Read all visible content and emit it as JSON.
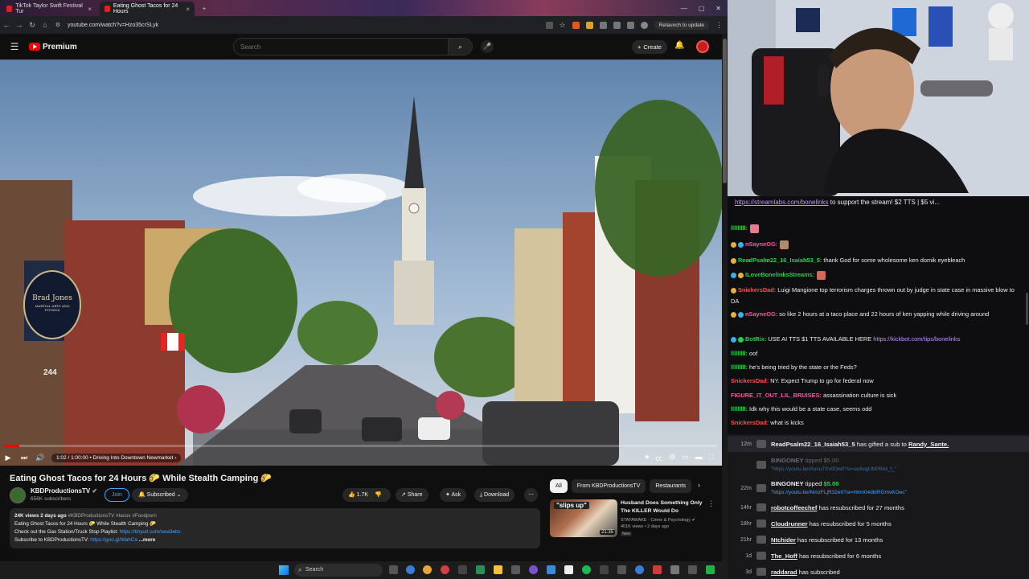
{
  "browser": {
    "tabs": [
      {
        "label": "TikTok Taylor Swift Festival Tur"
      },
      {
        "label": "Eating Ghost Tacos for 24 Hours"
      }
    ],
    "url": "youtube.com/watch?v=Hzo35crSLyk",
    "relaunch_label": "Relaunch to update"
  },
  "youtube": {
    "logo_text": "Premium",
    "search_placeholder": "Search",
    "create_label": "Create",
    "video": {
      "progress": 0.02,
      "time": "1:02 / 1:00:00",
      "chapter": "Driving Into Downtown Newmarket",
      "sign_text": "Brad Jones",
      "sign_sub": "MARTIAL ARTS AND FITNESS",
      "address_number": "244"
    },
    "title": "Eating Ghost Tacos for 24 Hours 🌮 While Stealth Camping 🌮",
    "channel": {
      "name": "KBDProductionsTV",
      "subscribers": "656K subscribers",
      "join_label": "Join",
      "subscribed_label": "Subscribed"
    },
    "actions": {
      "likes": "1.7K",
      "share": "Share",
      "ask": "Ask",
      "download": "Download"
    },
    "description": {
      "meta": "24K views  2 days ago",
      "tags": "#KBDProductionsTV #tacos #Foodporn",
      "line1": "Eating Ghost Tacos for 24 Hours 🌮 While Stealth Camping 🌮",
      "line2_prefix": "Check out the Gas Station/Truck Stop Playlist: ",
      "line2_link": "https://tinyurl.com/swa3ebs",
      "line3_prefix": "Subscribe to KBDProductionsTV: ",
      "line3_link": "https://goo.gl/WahCa",
      "more": "...more"
    },
    "chips": [
      "All",
      "From KBDProductionsTV",
      "Restaurants"
    ],
    "recommendation": {
      "thumb_caption": "\"slips up\"",
      "duration": "21:35",
      "title": "Husband Does Something Only The KILLER Would Do",
      "channel": "STAYAWAKE - Crime & Psychology",
      "views": "401K views • 2 days ago",
      "badge": "New"
    }
  },
  "taskbar": {
    "search_label": "Search"
  },
  "chat": {
    "top_link": "https://streamlabs.com/bonelinks",
    "top_text": " to support the stream! $2 TTS | $5 vi...",
    "messages": [
      {
        "user": "lllllllll:",
        "text": "",
        "color": "#1fd34a"
      },
      {
        "user": "nSayneOG:",
        "text": "",
        "color": "#ff4fa6"
      },
      {
        "user": "ReadPsalm22_16_Isaiah53_5:",
        "text": " thank God for some wholesome ken domik eyebleach",
        "color": "#1fd34a"
      },
      {
        "user": "ILoveBonelinksStreams:",
        "text": "",
        "color": "#1fd34a"
      },
      {
        "user": "SnickersDad:",
        "text": " Luigi Mangione top terrorism charges thrown out by judge in state case in massive blow to DA",
        "color": "#ff4f4f"
      },
      {
        "user": "nSayneOG:",
        "text": " so like 2 hours at a taco place and 22 hours of ken yapping while driving around",
        "color": "#ff4fa6"
      },
      {
        "user": "BotRix:",
        "text": " USE AI TTS $1 TTS AVAILABLE HERE ",
        "link": "https://kickbot.com/tips/bonelinks",
        "color": "#1fd34a"
      },
      {
        "user": "lllllllll:",
        "text": " oof",
        "color": "#1fd34a"
      },
      {
        "user": "lllllllll:",
        "text": " he's being tried by the state or the Feds?",
        "color": "#1fd34a"
      },
      {
        "user": "SnickersDad:",
        "text": " NY. Expect Trump to go for federal now",
        "color": "#ff4f4f"
      },
      {
        "user": "FIGURE_IT_OUT_LIL_BRUISES:",
        "text": " assassination culture is sick",
        "color": "#ff4fa6"
      },
      {
        "user": "lllllllll:",
        "text": " Idk why this would be a state case, seems odd",
        "color": "#1fd34a"
      },
      {
        "user": "SnickersDad:",
        "text": " what is kicks",
        "color": "#ff4f4f"
      }
    ]
  },
  "events": [
    {
      "time": "12m",
      "user": "ReadPsalm22_16_Isaiah53_5",
      "text": " has gifted a sub to ",
      "user2": "Randy_Sante."
    },
    {
      "time": "",
      "user": "BINGONEY",
      "text": " tipped ",
      "amount": "$5.00",
      "link": "\"https://youtu.be/Aucu7Xv0Owlf?si=av9vgLtbPBiid_f_\"",
      "dim": true
    },
    {
      "time": "22m",
      "user": "BINGONEY",
      "text": " tipped ",
      "amount": "$5.00",
      "link": "\"https://youtu.be/NmzFLjR32e0?si=Hmn04dbiRGmvKOec\""
    },
    {
      "time": "14hr",
      "user": "robotcoffeechef",
      "text": " has resubscribed for 27 months"
    },
    {
      "time": "18hr",
      "user": "Cloudrunner",
      "text": " has resubscribed for 5 months"
    },
    {
      "time": "21hr",
      "user": "Ntchider",
      "text": " has resubscribed for 13 months"
    },
    {
      "time": "1d",
      "user": "The_Hoff",
      "text": " has resubscribed for 6 months"
    },
    {
      "time": "3d",
      "user": "raddarad",
      "text": " has subscribed"
    }
  ]
}
